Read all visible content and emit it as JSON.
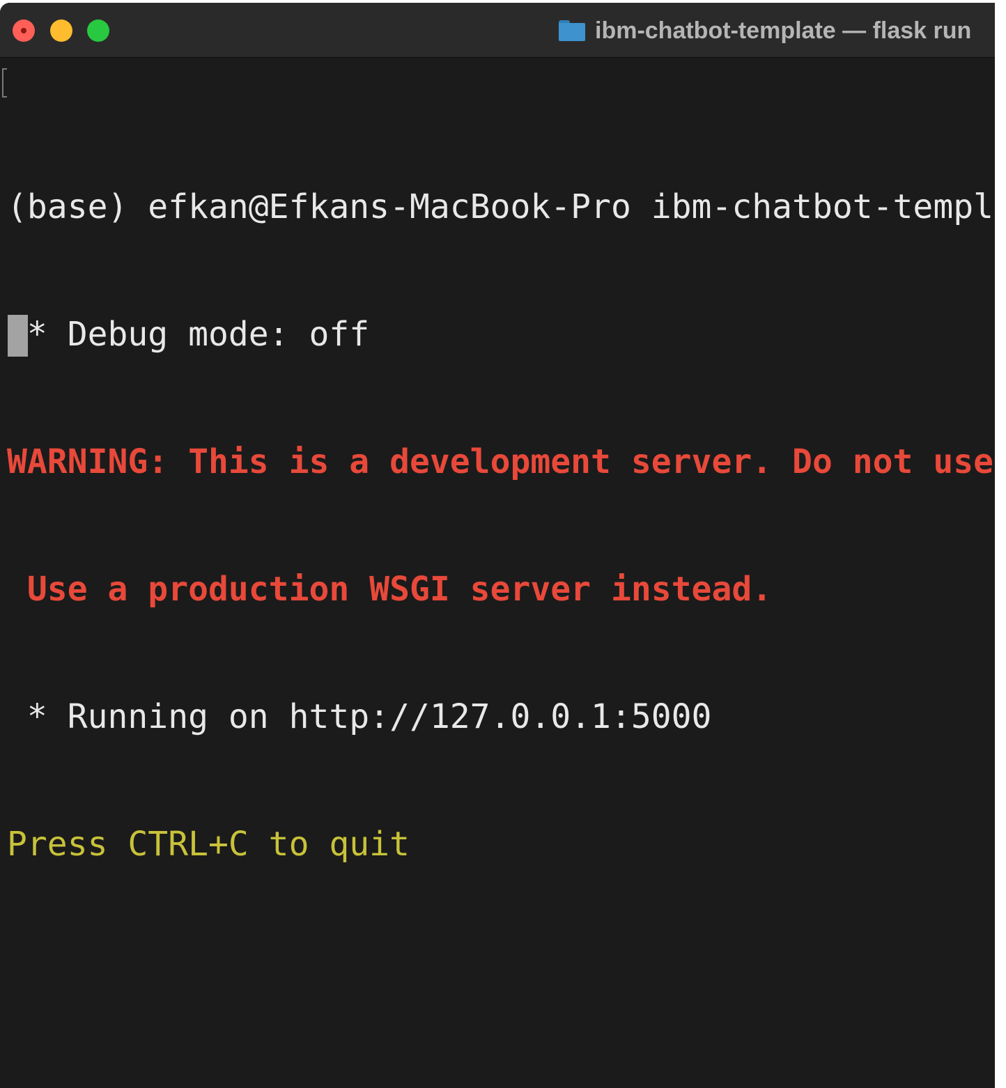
{
  "window": {
    "title": "ibm-chatbot-template — flask run",
    "folder_icon": "folder-icon"
  },
  "colors": {
    "background": "#1b1b1b",
    "text": "#e8e8e8",
    "warning": "#e8493a",
    "hint": "#c8c23a",
    "close": "#ff5f57",
    "minimize": "#febc2e",
    "maximize": "#28c840"
  },
  "terminal": {
    "lines": [
      {
        "text": "(base) efkan@Efkans-MacBook-Pro ibm-chatbot-template % flask run",
        "style": "normal"
      },
      {
        "text": " * Debug mode: off",
        "style": "normal"
      },
      {
        "text": "WARNING: This is a development server. Do not use it in a production deployment.",
        "style": "warning"
      },
      {
        "text": " Use a production WSGI server instead.",
        "style": "warning"
      },
      {
        "text": " * Running on http://127.0.0.1:5000",
        "style": "normal"
      },
      {
        "text": "Press CTRL+C to quit",
        "style": "hint"
      }
    ]
  }
}
